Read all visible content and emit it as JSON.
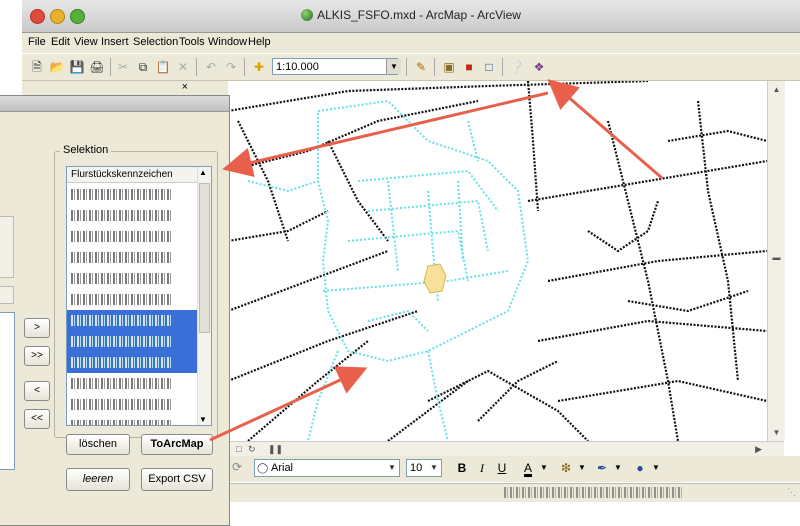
{
  "window": {
    "title": "ALKIS_FSFO.mxd - ArcMap - ArcView"
  },
  "menu": [
    "File",
    "Edit",
    "View",
    "Insert",
    "Selection",
    "Tools",
    "Window",
    "Help"
  ],
  "toolbar": {
    "scale": "1:10.000"
  },
  "drawing": {
    "font": "Arial",
    "size": "10",
    "bold": "B",
    "italic": "I",
    "underline": "U",
    "font_color": "A"
  },
  "dialog": {
    "group_label": "Selektion",
    "list_header": "Flurstückskennzeichen",
    "rows": [
      {
        "selected": false
      },
      {
        "selected": false
      },
      {
        "selected": false
      },
      {
        "selected": false
      },
      {
        "selected": false
      },
      {
        "selected": false
      },
      {
        "selected": true
      },
      {
        "selected": true
      },
      {
        "selected": true
      },
      {
        "selected": false
      },
      {
        "selected": false
      },
      {
        "selected": false
      }
    ],
    "move_buttons": [
      ">",
      ">>",
      "<",
      "<<"
    ],
    "loeschen": "löschen",
    "to_arcmap": "ToArcMap",
    "leeren": "leeren",
    "export_csv": "Export CSV"
  },
  "colors": {
    "selection": "#3a6fd8",
    "annotation_arrow": "#e8604c",
    "map_highlight": "#66e0e8",
    "parcel_fill": "#f7e09a"
  }
}
